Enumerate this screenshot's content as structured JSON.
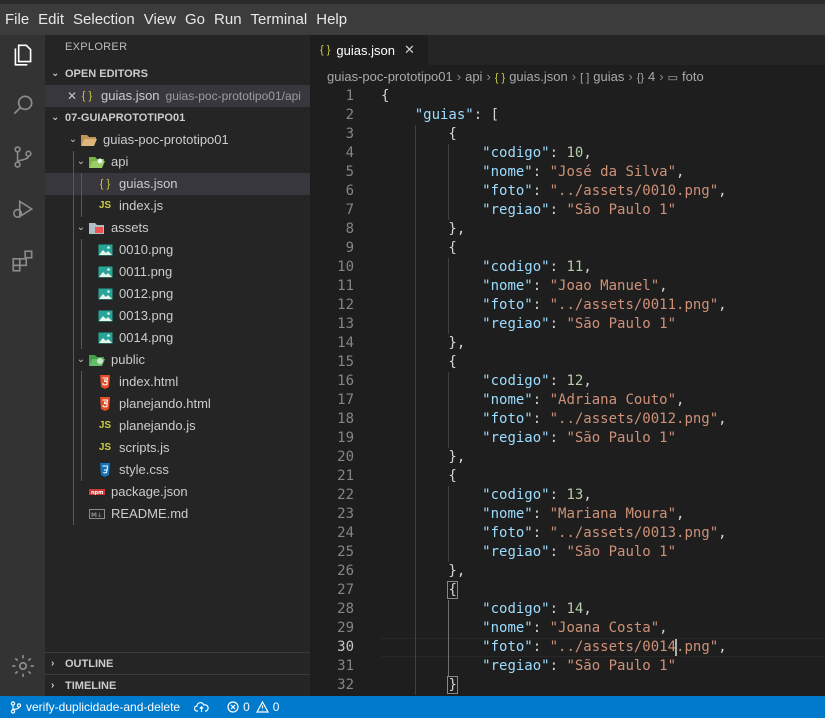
{
  "menu": [
    "File",
    "Edit",
    "Selection",
    "View",
    "Go",
    "Run",
    "Terminal",
    "Help"
  ],
  "activity_bar": [
    "explorer-icon",
    "search-icon",
    "source-control-icon",
    "run-debug-icon",
    "extensions-icon",
    "manage-gear-icon"
  ],
  "sidebar": {
    "title": "EXPLORER",
    "open_editors": {
      "label": "OPEN EDITORS",
      "items": [
        {
          "name": "guias.json",
          "path": "guias-poc-prototipo01/api"
        }
      ]
    },
    "workspace": {
      "label": "07-GUIAPROTOTIPO01",
      "tree": [
        {
          "label": "guias-poc-prototipo01",
          "kind": "folder-open",
          "depth": 0
        },
        {
          "label": "api",
          "kind": "folder-api",
          "depth": 1
        },
        {
          "label": "guias.json",
          "kind": "json",
          "depth": 2,
          "selected": true
        },
        {
          "label": "index.js",
          "kind": "js",
          "depth": 2
        },
        {
          "label": "assets",
          "kind": "folder-assets",
          "depth": 1
        },
        {
          "label": "0010.png",
          "kind": "image",
          "depth": 2
        },
        {
          "label": "0011.png",
          "kind": "image",
          "depth": 2
        },
        {
          "label": "0012.png",
          "kind": "image",
          "depth": 2
        },
        {
          "label": "0013.png",
          "kind": "image",
          "depth": 2
        },
        {
          "label": "0014.png",
          "kind": "image",
          "depth": 2
        },
        {
          "label": "public",
          "kind": "folder-public",
          "depth": 1
        },
        {
          "label": "index.html",
          "kind": "html",
          "depth": 2
        },
        {
          "label": "planejando.html",
          "kind": "html",
          "depth": 2
        },
        {
          "label": "planejando.js",
          "kind": "js",
          "depth": 2
        },
        {
          "label": "scripts.js",
          "kind": "js",
          "depth": 2
        },
        {
          "label": "style.css",
          "kind": "css",
          "depth": 2
        },
        {
          "label": "package.json",
          "kind": "npm",
          "depth": 1
        },
        {
          "label": "README.md",
          "kind": "md",
          "depth": 1
        }
      ]
    },
    "outline_label": "OUTLINE",
    "timeline_label": "TIMELINE"
  },
  "tab": {
    "label": "guias.json",
    "icon_text": "{ }",
    "close_glyph": "✕"
  },
  "breadcrumb": [
    {
      "icon": "",
      "text": "guias-poc-prototipo01"
    },
    {
      "icon": "",
      "text": "api"
    },
    {
      "icon": "{ }",
      "text": "guias.json"
    },
    {
      "icon": "[ ]",
      "text": "guias"
    },
    {
      "icon": "{}",
      "text": "4"
    },
    {
      "icon": "▭",
      "text": "foto"
    }
  ],
  "editor": {
    "active_line": 30,
    "lines": [
      "{",
      "    \"guias\": [",
      "        {",
      "            \"codigo\": 10,",
      "            \"nome\": \"José da Silva\",",
      "            \"foto\": \"../assets/0010.png\",",
      "            \"regiao\": \"São Paulo 1\"",
      "        },",
      "        {",
      "            \"codigo\": 11,",
      "            \"nome\": \"Joao Manuel\",",
      "            \"foto\": \"../assets/0011.png\",",
      "            \"regiao\": \"São Paulo 1\"",
      "        },",
      "        {",
      "            \"codigo\": 12,",
      "            \"nome\": \"Adriana Couto\",",
      "            \"foto\": \"../assets/0012.png\",",
      "            \"regiao\": \"São Paulo 1\"",
      "        },",
      "        {",
      "            \"codigo\": 13,",
      "            \"nome\": \"Mariana Moura\",",
      "            \"foto\": \"../assets/0013.png\",",
      "            \"regiao\": \"São Paulo 1\"",
      "        },",
      "        {",
      "            \"codigo\": 14,",
      "            \"nome\": \"Joana Costa\",",
      "            \"foto\": \"../assets/0014.png\",",
      "            \"regiao\": \"São Paulo 1\"",
      "        }"
    ]
  },
  "statusbar": {
    "branch": "verify-duplicidade-and-delete",
    "errors": "0",
    "warnings": "0"
  },
  "colors": {
    "accent": "#007acc",
    "json_icon": "#cbcb41",
    "js_icon": "#cbcb41",
    "html_icon": "#e44d26",
    "css_icon": "#1572b6",
    "image_icon": "#26a69a"
  }
}
